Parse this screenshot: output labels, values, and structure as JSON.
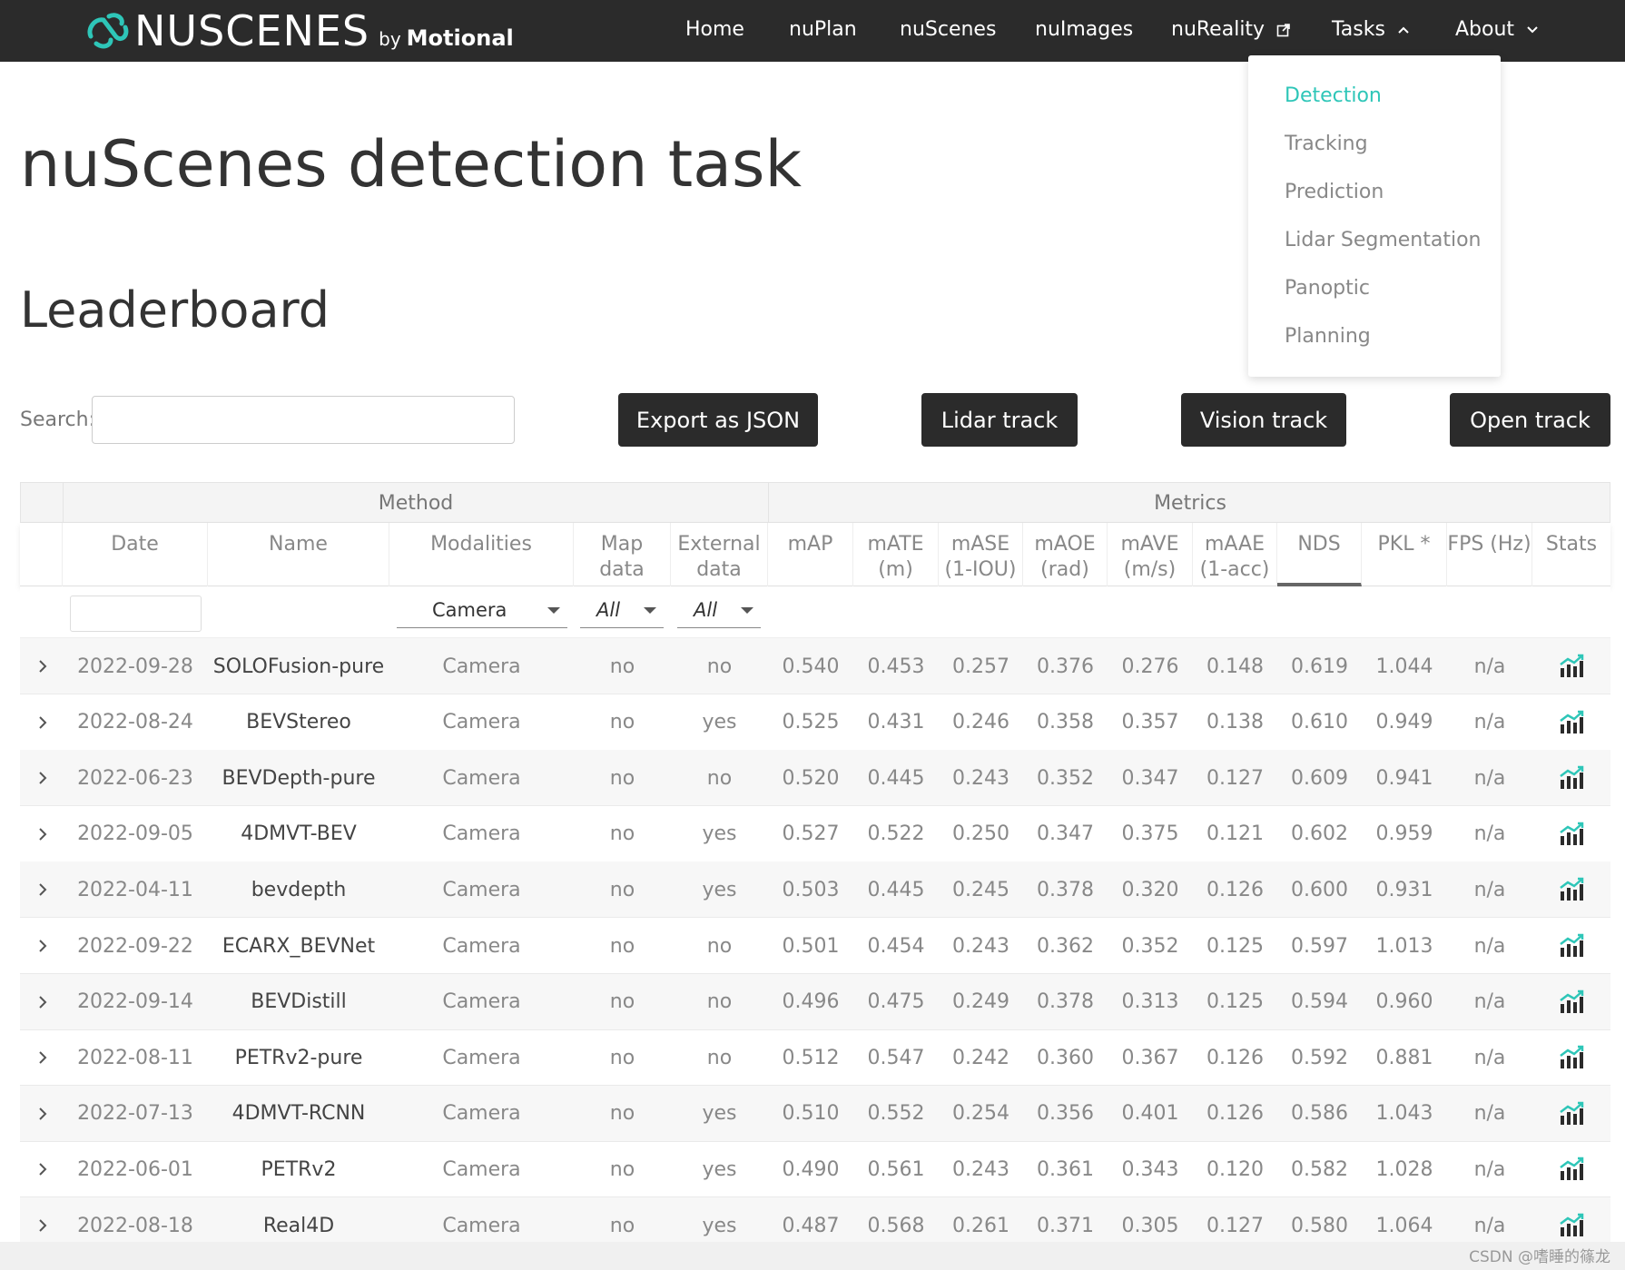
{
  "navbar": {
    "brand_name": "NUSCENES",
    "brand_by": "by",
    "brand_company": "Motional",
    "items": [
      {
        "label": "Home"
      },
      {
        "label": "nuPlan"
      },
      {
        "label": "nuScenes"
      },
      {
        "label": "nuImages"
      },
      {
        "label": "nuReality"
      },
      {
        "label": "Tasks"
      },
      {
        "label": "About"
      }
    ]
  },
  "tasks_menu": {
    "items": [
      {
        "label": "Detection",
        "active": true
      },
      {
        "label": "Tracking"
      },
      {
        "label": "Prediction"
      },
      {
        "label": "Lidar Segmentation"
      },
      {
        "label": "Panoptic"
      },
      {
        "label": "Planning"
      }
    ]
  },
  "page": {
    "title": "nuScenes detection task",
    "section": "Leaderboard"
  },
  "search": {
    "label": "Search:",
    "value": ""
  },
  "buttons": {
    "export": "Export as JSON",
    "lidar": "Lidar track",
    "vision": "Vision track",
    "open": "Open track"
  },
  "table": {
    "groups": {
      "method": "Method",
      "metrics": "Metrics"
    },
    "headers": {
      "date": "Date",
      "name": "Name",
      "modalities": "Modalities",
      "map_1": "Map",
      "map_2": "data",
      "ext_1": "External",
      "ext_2": "data",
      "map_metric": "mAP",
      "mate_1": "mATE",
      "mate_2": "(m)",
      "mase_1": "mASE",
      "mase_2": "(1-IOU)",
      "maoe_1": "mAOE",
      "maoe_2": "(rad)",
      "mave_1": "mAVE",
      "mave_2": "(m/s)",
      "maae_1": "mAAE",
      "maae_2": "(1-acc)",
      "nds": "NDS",
      "pkl": "PKL *",
      "fps": "FPS (Hz)",
      "stats": "Stats"
    },
    "filters": {
      "modality": "Camera",
      "map": "All",
      "external": "All"
    },
    "rows": [
      {
        "date": "2022-09-28",
        "name": "SOLOFusion-pure",
        "modalities": "Camera",
        "map": "no",
        "external": "no",
        "mAP": "0.540",
        "mATE": "0.453",
        "mASE": "0.257",
        "mAOE": "0.376",
        "mAVE": "0.276",
        "mAAE": "0.148",
        "NDS": "0.619",
        "PKL": "1.044",
        "FPS": "n/a"
      },
      {
        "date": "2022-08-24",
        "name": "BEVStereo",
        "modalities": "Camera",
        "map": "no",
        "external": "yes",
        "mAP": "0.525",
        "mATE": "0.431",
        "mASE": "0.246",
        "mAOE": "0.358",
        "mAVE": "0.357",
        "mAAE": "0.138",
        "NDS": "0.610",
        "PKL": "0.949",
        "FPS": "n/a"
      },
      {
        "date": "2022-06-23",
        "name": "BEVDepth-pure",
        "modalities": "Camera",
        "map": "no",
        "external": "no",
        "mAP": "0.520",
        "mATE": "0.445",
        "mASE": "0.243",
        "mAOE": "0.352",
        "mAVE": "0.347",
        "mAAE": "0.127",
        "NDS": "0.609",
        "PKL": "0.941",
        "FPS": "n/a"
      },
      {
        "date": "2022-09-05",
        "name": "4DMVT-BEV",
        "modalities": "Camera",
        "map": "no",
        "external": "yes",
        "mAP": "0.527",
        "mATE": "0.522",
        "mASE": "0.250",
        "mAOE": "0.347",
        "mAVE": "0.375",
        "mAAE": "0.121",
        "NDS": "0.602",
        "PKL": "0.959",
        "FPS": "n/a"
      },
      {
        "date": "2022-04-11",
        "name": "bevdepth",
        "modalities": "Camera",
        "map": "no",
        "external": "yes",
        "mAP": "0.503",
        "mATE": "0.445",
        "mASE": "0.245",
        "mAOE": "0.378",
        "mAVE": "0.320",
        "mAAE": "0.126",
        "NDS": "0.600",
        "PKL": "0.931",
        "FPS": "n/a"
      },
      {
        "date": "2022-09-22",
        "name": "ECARX_BEVNet",
        "modalities": "Camera",
        "map": "no",
        "external": "no",
        "mAP": "0.501",
        "mATE": "0.454",
        "mASE": "0.243",
        "mAOE": "0.362",
        "mAVE": "0.352",
        "mAAE": "0.125",
        "NDS": "0.597",
        "PKL": "1.013",
        "FPS": "n/a"
      },
      {
        "date": "2022-09-14",
        "name": "BEVDistill",
        "modalities": "Camera",
        "map": "no",
        "external": "no",
        "mAP": "0.496",
        "mATE": "0.475",
        "mASE": "0.249",
        "mAOE": "0.378",
        "mAVE": "0.313",
        "mAAE": "0.125",
        "NDS": "0.594",
        "PKL": "0.960",
        "FPS": "n/a"
      },
      {
        "date": "2022-08-11",
        "name": "PETRv2-pure",
        "modalities": "Camera",
        "map": "no",
        "external": "no",
        "mAP": "0.512",
        "mATE": "0.547",
        "mASE": "0.242",
        "mAOE": "0.360",
        "mAVE": "0.367",
        "mAAE": "0.126",
        "NDS": "0.592",
        "PKL": "0.881",
        "FPS": "n/a"
      },
      {
        "date": "2022-07-13",
        "name": "4DMVT-RCNN",
        "modalities": "Camera",
        "map": "no",
        "external": "yes",
        "mAP": "0.510",
        "mATE": "0.552",
        "mASE": "0.254",
        "mAOE": "0.356",
        "mAVE": "0.401",
        "mAAE": "0.126",
        "NDS": "0.586",
        "PKL": "1.043",
        "FPS": "n/a"
      },
      {
        "date": "2022-06-01",
        "name": "PETRv2",
        "modalities": "Camera",
        "map": "no",
        "external": "yes",
        "mAP": "0.490",
        "mATE": "0.561",
        "mASE": "0.243",
        "mAOE": "0.361",
        "mAVE": "0.343",
        "mAAE": "0.120",
        "NDS": "0.582",
        "PKL": "1.028",
        "FPS": "n/a"
      },
      {
        "date": "2022-08-18",
        "name": "Real4D",
        "modalities": "Camera",
        "map": "no",
        "external": "yes",
        "mAP": "0.487",
        "mATE": "0.568",
        "mASE": "0.261",
        "mAOE": "0.371",
        "mAVE": "0.305",
        "mAAE": "0.127",
        "NDS": "0.580",
        "PKL": "1.064",
        "FPS": "n/a"
      }
    ]
  },
  "watermark": "CSDN @嗜睡的篠龙",
  "colors": {
    "accent": "#2ec6b8",
    "navbar": "#2b2b2b"
  }
}
